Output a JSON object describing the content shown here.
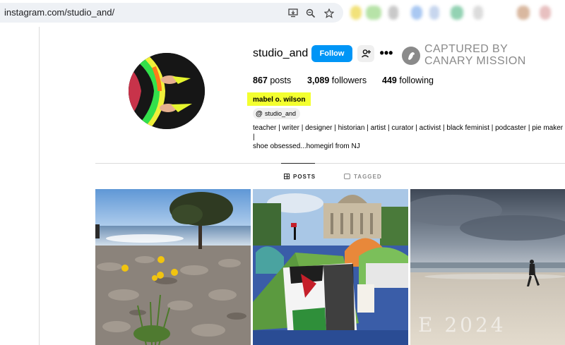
{
  "browser": {
    "url": "instagram.com/studio_and/"
  },
  "profile": {
    "username": "studio_and",
    "follow_label": "Follow",
    "stats": {
      "posts_count": "867",
      "posts_label": "posts",
      "followers_count": "3,089",
      "followers_label": "followers",
      "following_count": "449",
      "following_label": "following"
    },
    "real_name": "mabel o. wilson",
    "threads_handle": "studio_and",
    "bio_line1": "teacher | writer | designer | historian | artist | curator | activist | black feminist | podcaster | pie maker |",
    "bio_line2": "shoe obsessed...homegirl from NJ"
  },
  "watermark": {
    "line1": "CAPTURED BY",
    "line2": "CANARY MISSION"
  },
  "tabs": {
    "posts": "POSTS",
    "tagged": "TAGGED"
  },
  "posts_overlay_text": "E 2024",
  "colors": {
    "follow_blue": "#0095f6",
    "highlight_yellow": "#f3ff2f",
    "divider": "#dbdbdb"
  }
}
